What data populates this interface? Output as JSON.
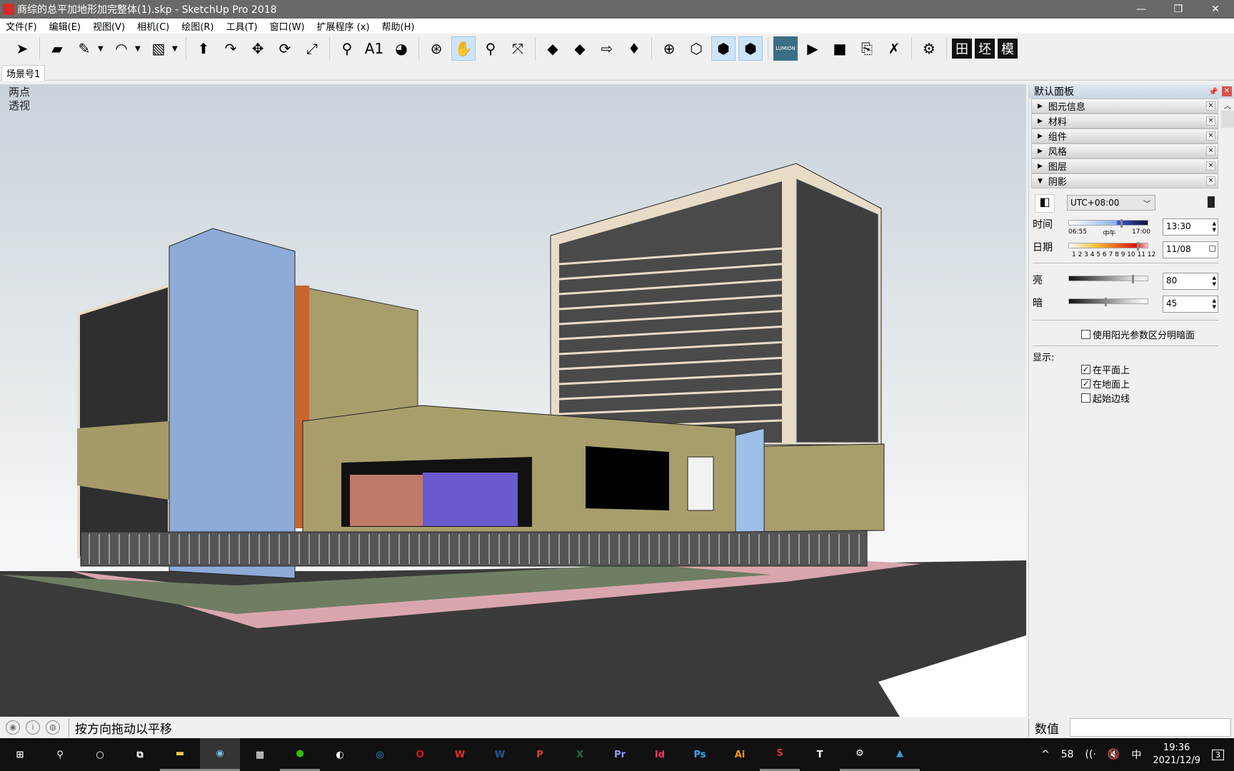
{
  "window": {
    "title": "商综的总平加地形加完整体(1).skp - SketchUp Pro 2018",
    "controls": [
      "—",
      "❐",
      "✕"
    ]
  },
  "menu": [
    "文件(F)",
    "编辑(E)",
    "视图(V)",
    "相机(C)",
    "绘图(R)",
    "工具(T)",
    "窗口(W)",
    "扩展程序 (x)",
    "帮助(H)"
  ],
  "toolbar": {
    "buttons": [
      {
        "name": "select",
        "glyph": "➤"
      },
      {
        "name": "eraser",
        "glyph": "▰"
      },
      {
        "name": "pencil",
        "glyph": "✎"
      },
      {
        "name": "arc",
        "glyph": "◠"
      },
      {
        "name": "rectangle",
        "glyph": "▧"
      },
      {
        "name": "push-pull",
        "glyph": "⬆"
      },
      {
        "name": "follow-me",
        "glyph": "↷"
      },
      {
        "name": "move",
        "glyph": "✥"
      },
      {
        "name": "rotate",
        "glyph": "⟳"
      },
      {
        "name": "scale",
        "glyph": "⤢"
      },
      {
        "name": "tape-measure",
        "glyph": "⚲"
      },
      {
        "name": "text",
        "glyph": "A1"
      },
      {
        "name": "paint-bucket",
        "glyph": "◕"
      },
      {
        "name": "orbit",
        "glyph": "⊛"
      },
      {
        "name": "pan",
        "glyph": "✋"
      },
      {
        "name": "zoom",
        "glyph": "⚲"
      },
      {
        "name": "zoom-extents",
        "glyph": "⤧"
      },
      {
        "name": "warehouse",
        "glyph": "◆"
      },
      {
        "name": "components-3d",
        "glyph": "◆"
      },
      {
        "name": "share-model",
        "glyph": "⇨"
      },
      {
        "name": "ruby",
        "glyph": "♦"
      },
      {
        "name": "position-camera",
        "glyph": "⊕"
      },
      {
        "name": "section-plane",
        "glyph": "⬡"
      },
      {
        "name": "display-section-planes",
        "glyph": "⬢"
      },
      {
        "name": "display-section-cuts",
        "glyph": "⬢"
      },
      {
        "name": "lumion",
        "glyph": "LUMION"
      },
      {
        "name": "play",
        "glyph": "▶"
      },
      {
        "name": "stop",
        "glyph": "■"
      },
      {
        "name": "camera-link",
        "glyph": "⎘"
      },
      {
        "name": "camera-delete",
        "glyph": "✗"
      },
      {
        "name": "settings",
        "glyph": "⚙"
      },
      {
        "name": "plugin-grid",
        "glyph": "田"
      },
      {
        "name": "plugin-pi",
        "glyph": "坯"
      },
      {
        "name": "plugin-mo",
        "glyph": "模"
      }
    ]
  },
  "scene_tab": "场景号1",
  "viewport": {
    "camera_label_1": "两点",
    "camera_label_2": "透视"
  },
  "panel": {
    "title": "默认面板",
    "trays": [
      "图元信息",
      "材料",
      "组件",
      "风格",
      "图层",
      "阴影"
    ],
    "shadow": {
      "timezone": "UTC+08:00",
      "time_label": "时间",
      "time_start": "06:55",
      "time_mid": "中午",
      "time_end": "17:00",
      "time_value": "13:30",
      "time_fraction": 0.65,
      "date_label": "日期",
      "date_ticks": "1 2 3 4 5 6 7 8 9 10 11 12",
      "date_value": "11/08",
      "date_fraction": 0.86,
      "light_label": "亮",
      "light_value": "80",
      "dark_label": "暗",
      "dark_value": "45",
      "use_sun": {
        "label": "使用阳光参数区分明暗面",
        "checked": false
      },
      "display_label": "显示:",
      "display_options": [
        {
          "label": "在平面上",
          "checked": true
        },
        {
          "label": "在地面上",
          "checked": true
        },
        {
          "label": "起始边线",
          "checked": false
        }
      ]
    }
  },
  "status": {
    "message": "按方向拖动以平移",
    "value_label": "数值",
    "value": ""
  },
  "taskbar": {
    "apps": [
      {
        "name": "start",
        "glyph": "⊞",
        "color": "#ffffff"
      },
      {
        "name": "search",
        "glyph": "⚲",
        "color": "#ffffff"
      },
      {
        "name": "cortana",
        "glyph": "○",
        "color": "#ffffff"
      },
      {
        "name": "task-view",
        "glyph": "⧉",
        "color": "#ffffff"
      },
      {
        "name": "file-explorer",
        "glyph": "▬",
        "color": "#f4c542"
      },
      {
        "name": "app-1",
        "glyph": "◉",
        "color": "#6fc3e8"
      },
      {
        "name": "store",
        "glyph": "▦",
        "color": "#ffffff"
      },
      {
        "name": "wechat",
        "glyph": "●",
        "color": "#2dc100"
      },
      {
        "name": "qq",
        "glyph": "◐",
        "color": "#ffffff"
      },
      {
        "name": "edge",
        "glyph": "◎",
        "color": "#1fa0e0"
      },
      {
        "name": "opera",
        "glyph": "O",
        "color": "#e0102a"
      },
      {
        "name": "wps",
        "glyph": "W",
        "color": "#e03020"
      },
      {
        "name": "word",
        "glyph": "W",
        "color": "#2b5797"
      },
      {
        "name": "powerpoint",
        "glyph": "P",
        "color": "#d24726"
      },
      {
        "name": "excel",
        "glyph": "X",
        "color": "#1d7044"
      },
      {
        "name": "premiere",
        "glyph": "Pr",
        "color": "#9999ff"
      },
      {
        "name": "indesign",
        "glyph": "Id",
        "color": "#ff3366"
      },
      {
        "name": "photoshop",
        "glyph": "Ps",
        "color": "#31a8ff"
      },
      {
        "name": "illustrator",
        "glyph": "Ai",
        "color": "#ff9a00"
      },
      {
        "name": "sketchup",
        "glyph": "S",
        "color": "#e03030"
      },
      {
        "name": "tool-t",
        "glyph": "T",
        "color": "#ffffff"
      },
      {
        "name": "settings",
        "glyph": "⚙",
        "color": "#ffffff"
      },
      {
        "name": "photos",
        "glyph": "▲",
        "color": "#3a9ad9"
      }
    ],
    "tray": {
      "chevron": "^",
      "temp": "58",
      "network": "((·",
      "volume": "🔇",
      "ime": "中",
      "time": "19:36",
      "date": "2021/12/9",
      "notifications": "3"
    }
  }
}
